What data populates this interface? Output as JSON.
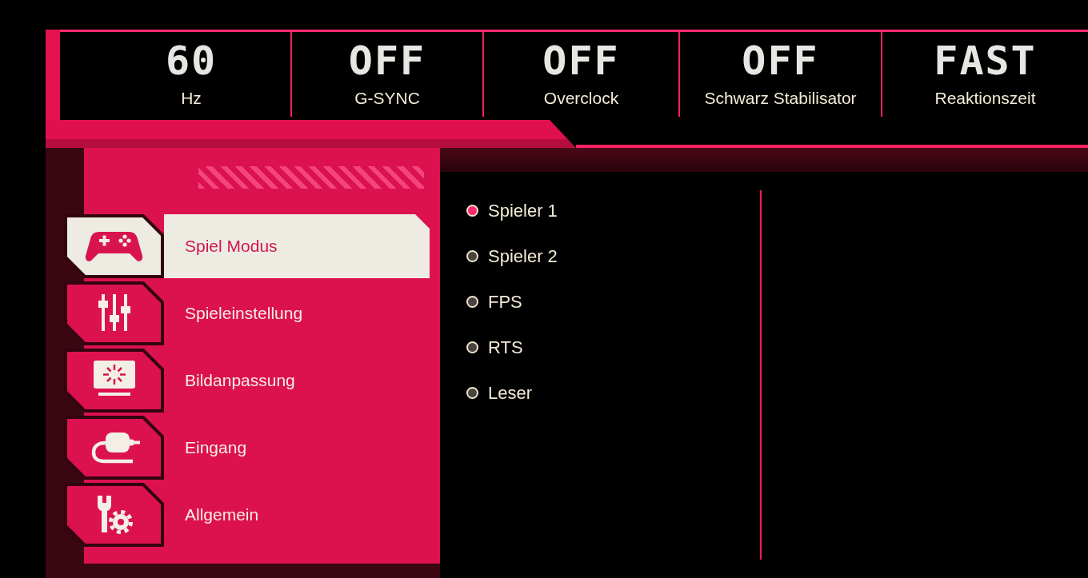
{
  "status_bar": {
    "items": [
      {
        "value": "60",
        "label": "Hz"
      },
      {
        "value": "OFF",
        "label": "G-SYNC"
      },
      {
        "value": "OFF",
        "label": "Overclock"
      },
      {
        "value": "OFF",
        "label": "Schwarz Stabilisator"
      },
      {
        "value": "FAST",
        "label": "Reaktionszeit"
      }
    ]
  },
  "menu": {
    "items": [
      {
        "label": "Spiel Modus",
        "selected": true
      },
      {
        "label": "Spieleinstellung",
        "selected": false
      },
      {
        "label": "Bildanpassung",
        "selected": false
      },
      {
        "label": "Eingang",
        "selected": false
      },
      {
        "label": "Allgemein",
        "selected": false
      }
    ]
  },
  "submenu": {
    "options": [
      {
        "label": "Spieler 1",
        "selected": true
      },
      {
        "label": "Spieler 2",
        "selected": false
      },
      {
        "label": "FPS",
        "selected": false
      },
      {
        "label": "RTS",
        "selected": false
      },
      {
        "label": "Leser",
        "selected": false
      }
    ]
  }
}
